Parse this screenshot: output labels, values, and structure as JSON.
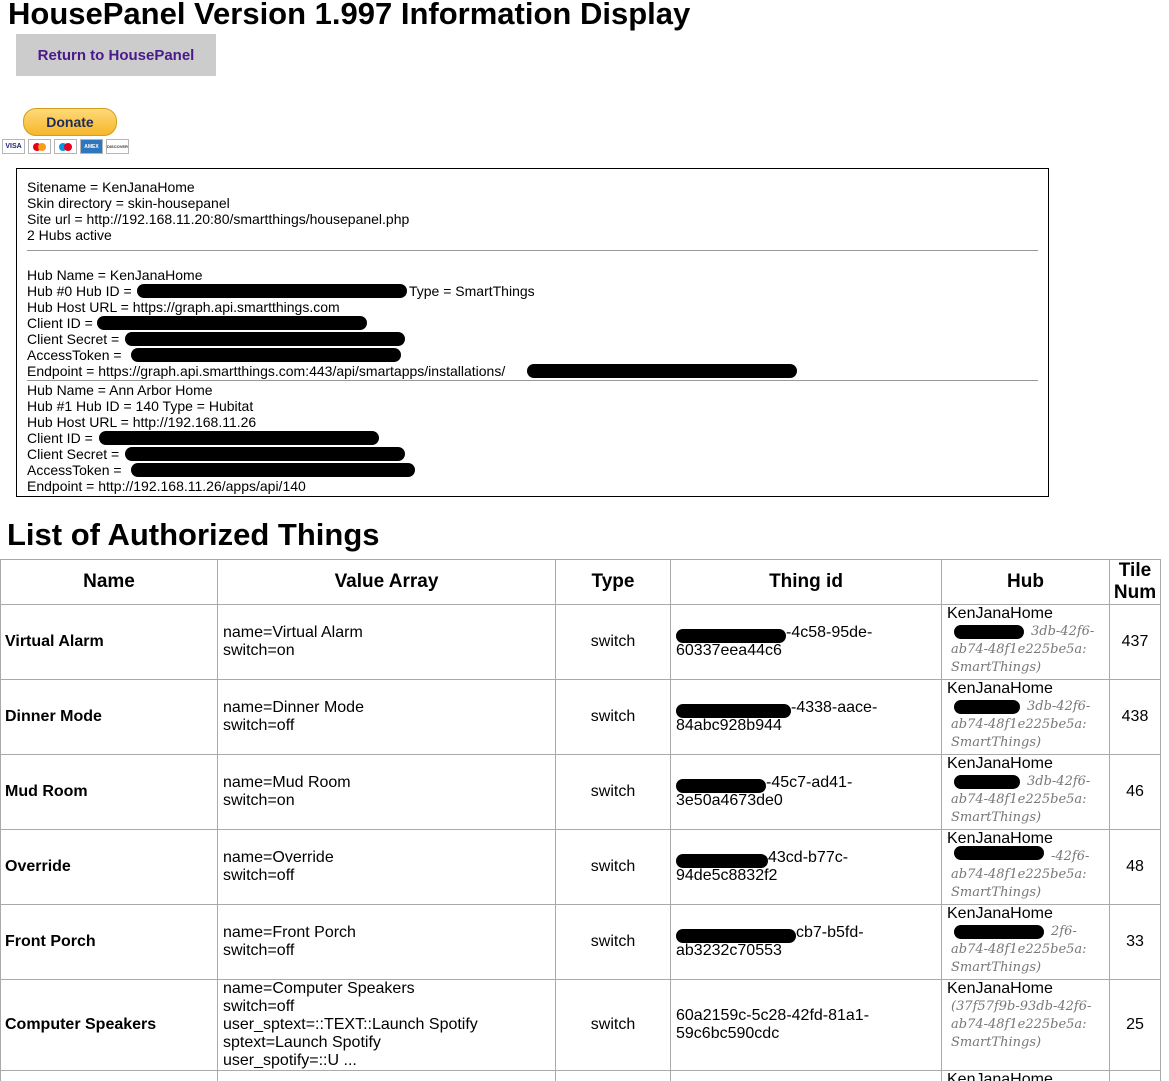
{
  "page_title": "HousePanel Version 1.997 Information Display",
  "return_button": "Return to HousePanel",
  "donate": {
    "label": "Donate",
    "cards": [
      "VISA",
      "MasterCard",
      "Maestro",
      "AMERICAN EXPRESS",
      "DISCOVER"
    ]
  },
  "info": {
    "sitename": "Sitename = KenJanaHome",
    "skin": "Skin directory = skin-housepanel",
    "site_url": "Site url = http://192.168.11.20:80/smartthings/housepanel.php",
    "hubs_active": "2 Hubs active",
    "hubs": [
      {
        "name": "Hub Name = KenJanaHome",
        "id_prefix": "Hub #0 Hub ID = ",
        "id_suffix": "a Type = SmartThings",
        "host": "Hub Host URL = https://graph.api.smartthings.com",
        "client_id": "Client ID = ",
        "client_secret": "Client Secret = ",
        "access_token": "AccessToken = ",
        "endpoint": "Endpoint = https://graph.api.smartthings.com:443/api/smartapps/installations/"
      },
      {
        "name": "Hub Name = Ann Arbor Home",
        "id_prefix": "Hub #1 Hub ID = 140 Type = Hubitat",
        "id_suffix": "",
        "host": "Hub Host URL = http://192.168.11.26",
        "client_id": "Client ID = ",
        "client_secret": "Client Secret = ",
        "access_token": "AccessToken = ",
        "endpoint": "Endpoint = http://192.168.11.26/apps/api/140"
      }
    ]
  },
  "things_title": "List of Authorized Things",
  "table": {
    "headers": {
      "name": "Name",
      "value_array": "Value Array",
      "type": "Type",
      "thing_id": "Thing id",
      "hub": "Hub",
      "tile_num_1": "Tile",
      "tile_num_2": "Num"
    },
    "rows": [
      {
        "name": "Virtual Alarm",
        "values": [
          "name=Virtual Alarm",
          "switch=on"
        ],
        "type": "switch",
        "thing_id": [
          "-4c58-95de-",
          "60337eea44c6"
        ],
        "hub_name": "KenJanaHome",
        "hub_sub": [
          "3db-42f6-",
          "ab74-48f1e225be5a:",
          "SmartThings)"
        ],
        "tile": "437"
      },
      {
        "name": "Dinner Mode",
        "values": [
          "name=Dinner Mode",
          "switch=off"
        ],
        "type": "switch",
        "thing_id": [
          "-4338-aace-",
          "84abc928b944"
        ],
        "hub_name": "KenJanaHome",
        "hub_sub": [
          "3db-42f6-",
          "ab74-48f1e225be5a:",
          "SmartThings)"
        ],
        "tile": "438"
      },
      {
        "name": "Mud Room",
        "values": [
          "name=Mud Room",
          "switch=on"
        ],
        "type": "switch",
        "thing_id": [
          "-45c7-ad41-",
          "3e50a4673de0"
        ],
        "hub_name": "KenJanaHome",
        "hub_sub": [
          "3db-42f6-",
          "ab74-48f1e225be5a:",
          "SmartThings)"
        ],
        "tile": "46"
      },
      {
        "name": "Override",
        "values": [
          "name=Override",
          "switch=off"
        ],
        "type": "switch",
        "thing_id": [
          "43cd-b77c-",
          "94de5c8832f2"
        ],
        "hub_name": "KenJanaHome",
        "hub_sub": [
          "-42f6-",
          "ab74-48f1e225be5a:",
          "SmartThings)"
        ],
        "tile": "48"
      },
      {
        "name": "Front Porch",
        "values": [
          "name=Front Porch",
          "switch=off"
        ],
        "type": "switch",
        "thing_id": [
          "cb7-b5fd-",
          "ab3232c70553"
        ],
        "hub_name": "KenJanaHome",
        "hub_sub": [
          "2f6-",
          "ab74-48f1e225be5a:",
          "SmartThings)"
        ],
        "tile": "33"
      },
      {
        "name": "Computer Speakers",
        "values": [
          "name=Computer Speakers",
          "switch=off",
          "user_sptext=::TEXT::Launch Spotify",
          "sptext=Launch Spotify",
          "user_spotify=::U ..."
        ],
        "type": "switch",
        "thing_id": [
          "60a2159c-5c28-42fd-81a1-",
          "59c6bc590cdc"
        ],
        "hub_name": "KenJanaHome",
        "hub_sub": [
          "(37f57f9b-93db-42f6-",
          "ab74-48f1e225be5a:",
          "SmartThings)"
        ],
        "tile": "25"
      }
    ],
    "partial_row_hub": "KenJanaHome"
  }
}
